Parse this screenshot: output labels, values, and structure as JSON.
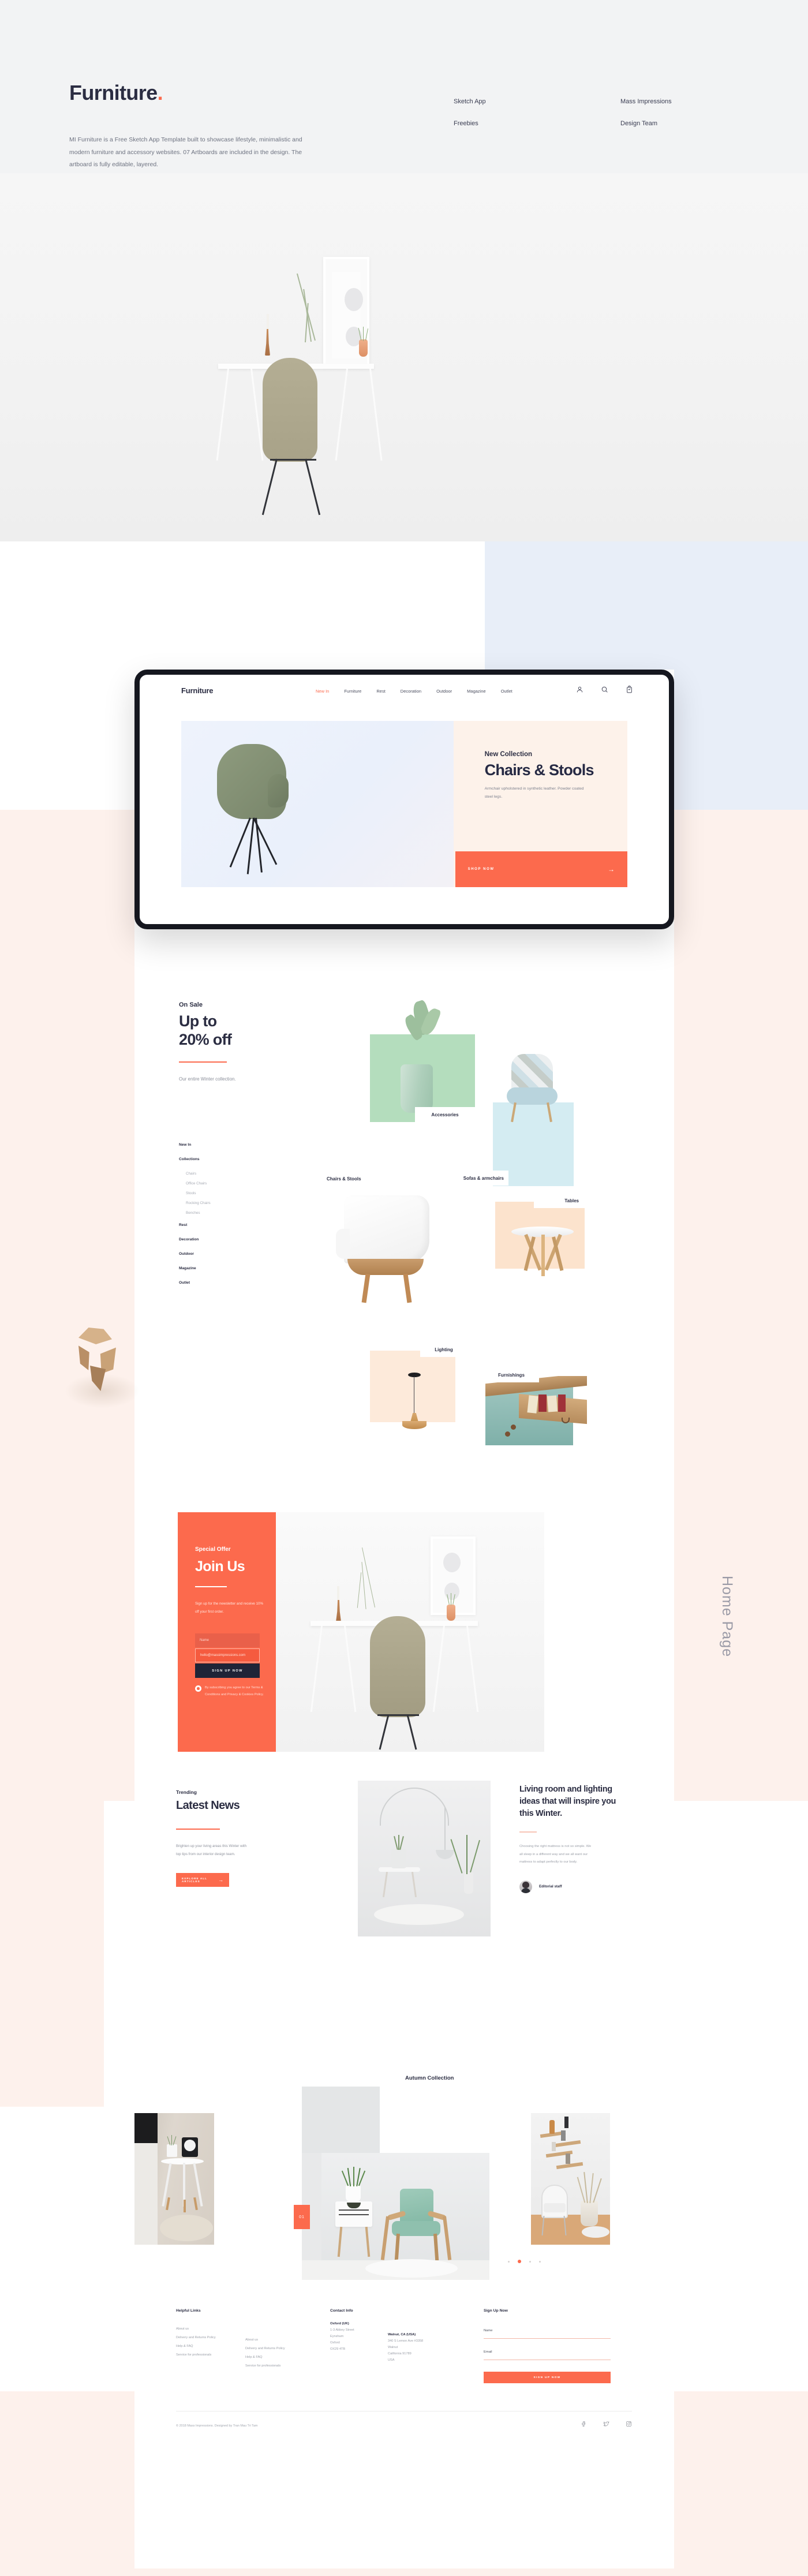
{
  "intro": {
    "logo": "Furniture",
    "logo_dot": ".",
    "description": "MI Furniture is a Free Sketch App Template built to showcase lifestyle, minimalistic and modern furniture and accessory websites. 07 Artboards are included in the design. The artboard is fully editable, layered.",
    "links": [
      {
        "label": "Sketch App"
      },
      {
        "label": "Freebies"
      },
      {
        "label": "Mass Impressions"
      },
      {
        "label": "Design Team"
      }
    ]
  },
  "browser": {
    "logo": "Furniture",
    "nav": [
      {
        "label": "New In",
        "active": true
      },
      {
        "label": "Furniture",
        "active": false
      },
      {
        "label": "Rest",
        "active": false
      },
      {
        "label": "Decoration",
        "active": false
      },
      {
        "label": "Outdoor",
        "active": false
      },
      {
        "label": "Magazine",
        "active": false
      },
      {
        "label": "Outlet",
        "active": false
      }
    ],
    "icons": [
      "account-icon",
      "search-icon",
      "cart-icon"
    ],
    "hero": {
      "eyebrow": "New Collection",
      "title": "Chairs & Stools",
      "subtitle": "Armchair upholstered in synthetic leather. Powder coated steel legs.",
      "cta_label": "SHOP NOW",
      "cta_arrow": "→"
    }
  },
  "sale": {
    "eyebrow": "On Sale",
    "title_line1": "Up to",
    "title_line2": "20% off",
    "description": "Our entire Winter collection.",
    "nav": [
      {
        "label": "New In",
        "type": "top"
      },
      {
        "label": "Collections",
        "type": "top"
      },
      {
        "label": "Chairs",
        "type": "sub"
      },
      {
        "label": "Office Chairs",
        "type": "sub"
      },
      {
        "label": "Stools",
        "type": "sub"
      },
      {
        "label": "Rocking Chairs",
        "type": "sub"
      },
      {
        "label": "Benches",
        "type": "sub"
      },
      {
        "label": "Rest",
        "type": "top"
      },
      {
        "label": "Decoration",
        "type": "top"
      },
      {
        "label": "Outdoor",
        "type": "top"
      },
      {
        "label": "Magazine",
        "type": "top"
      },
      {
        "label": "Outlet",
        "type": "top"
      }
    ],
    "categories": [
      {
        "label": "Accessories",
        "color": "#b4ddbd"
      },
      {
        "label": "Sofas & armchairs",
        "color": "#d4ecf2"
      },
      {
        "label": "Chairs & Stools",
        "color": "#ffffff"
      },
      {
        "label": "Tables",
        "color": "#fce3cd"
      },
      {
        "label": "Lighting",
        "color": "#fdeada"
      },
      {
        "label": "Furnishings",
        "color": "#ffffff"
      }
    ]
  },
  "join": {
    "eyebrow": "Special Offer",
    "title": "Join Us",
    "description": "Sign up for the newsletter and receive 10% off your first order.",
    "name_placeholder": "Name",
    "email_value": "hello@massimpressions.com",
    "button_label": "SIGN UP NOW",
    "terms": "By subscribing you agree to our Terms & Conditions and Privacy & Cookies Policy."
  },
  "page_label": "Home Page",
  "news": {
    "eyebrow": "Trending",
    "title": "Latest News",
    "description": "Brighten up your living areas this Winter with top tips from our interior design team.",
    "button_label": "EXPLORE ALL ARTICLES",
    "button_arrow": "→",
    "article_title": "Living room and lighting ideas that will inspire you this Winter.",
    "article_body": "Choosing the right mattress is not so simple. We all sleep in a different way and we all want our mattress to adapt perfectly to our body.",
    "author": "Editorial staff"
  },
  "autumn": {
    "title": "Autumn Collection",
    "badge": "01",
    "dots": 4,
    "active_dot": 2
  },
  "footer": {
    "helpful_links_heading": "Helpful Links",
    "helpful_links_col1": [
      "About us",
      "Delivery and Returns Policy",
      "Help & FAQ",
      "Service for professionals"
    ],
    "helpful_links_col2": [
      "About us",
      "Delivery and Returns Policy",
      "Help & FAQ",
      "Service for professionals"
    ],
    "contact_heading": "Contact Info",
    "address1_title": "Oxford (UK)",
    "address1_lines": [
      "1-3 Abbey Street",
      "Eynsham",
      "Oxford",
      "OX29 4TB"
    ],
    "address2_title": "Walnut, CA (USA)",
    "address2_lines": [
      "340 S Lemon Ave #3358",
      "Walnut",
      "California 91789",
      "USA"
    ],
    "signup_heading": "Sign Up Now",
    "name_label": "Name",
    "email_label": "Email",
    "signup_button": "SIGN UP NOW",
    "copyright": "© 2018 Mass Impressions. Designed by Tran Mau Tri Tam",
    "social": [
      "facebook-icon",
      "twitter-icon",
      "instagram-icon"
    ]
  },
  "colors": {
    "accent": "#fc6a4d",
    "dark": "#2b2d42",
    "peach_bg": "#fdf1ec",
    "blue_bg": "#e8eef8",
    "grey_bg": "#f2f3f4"
  }
}
